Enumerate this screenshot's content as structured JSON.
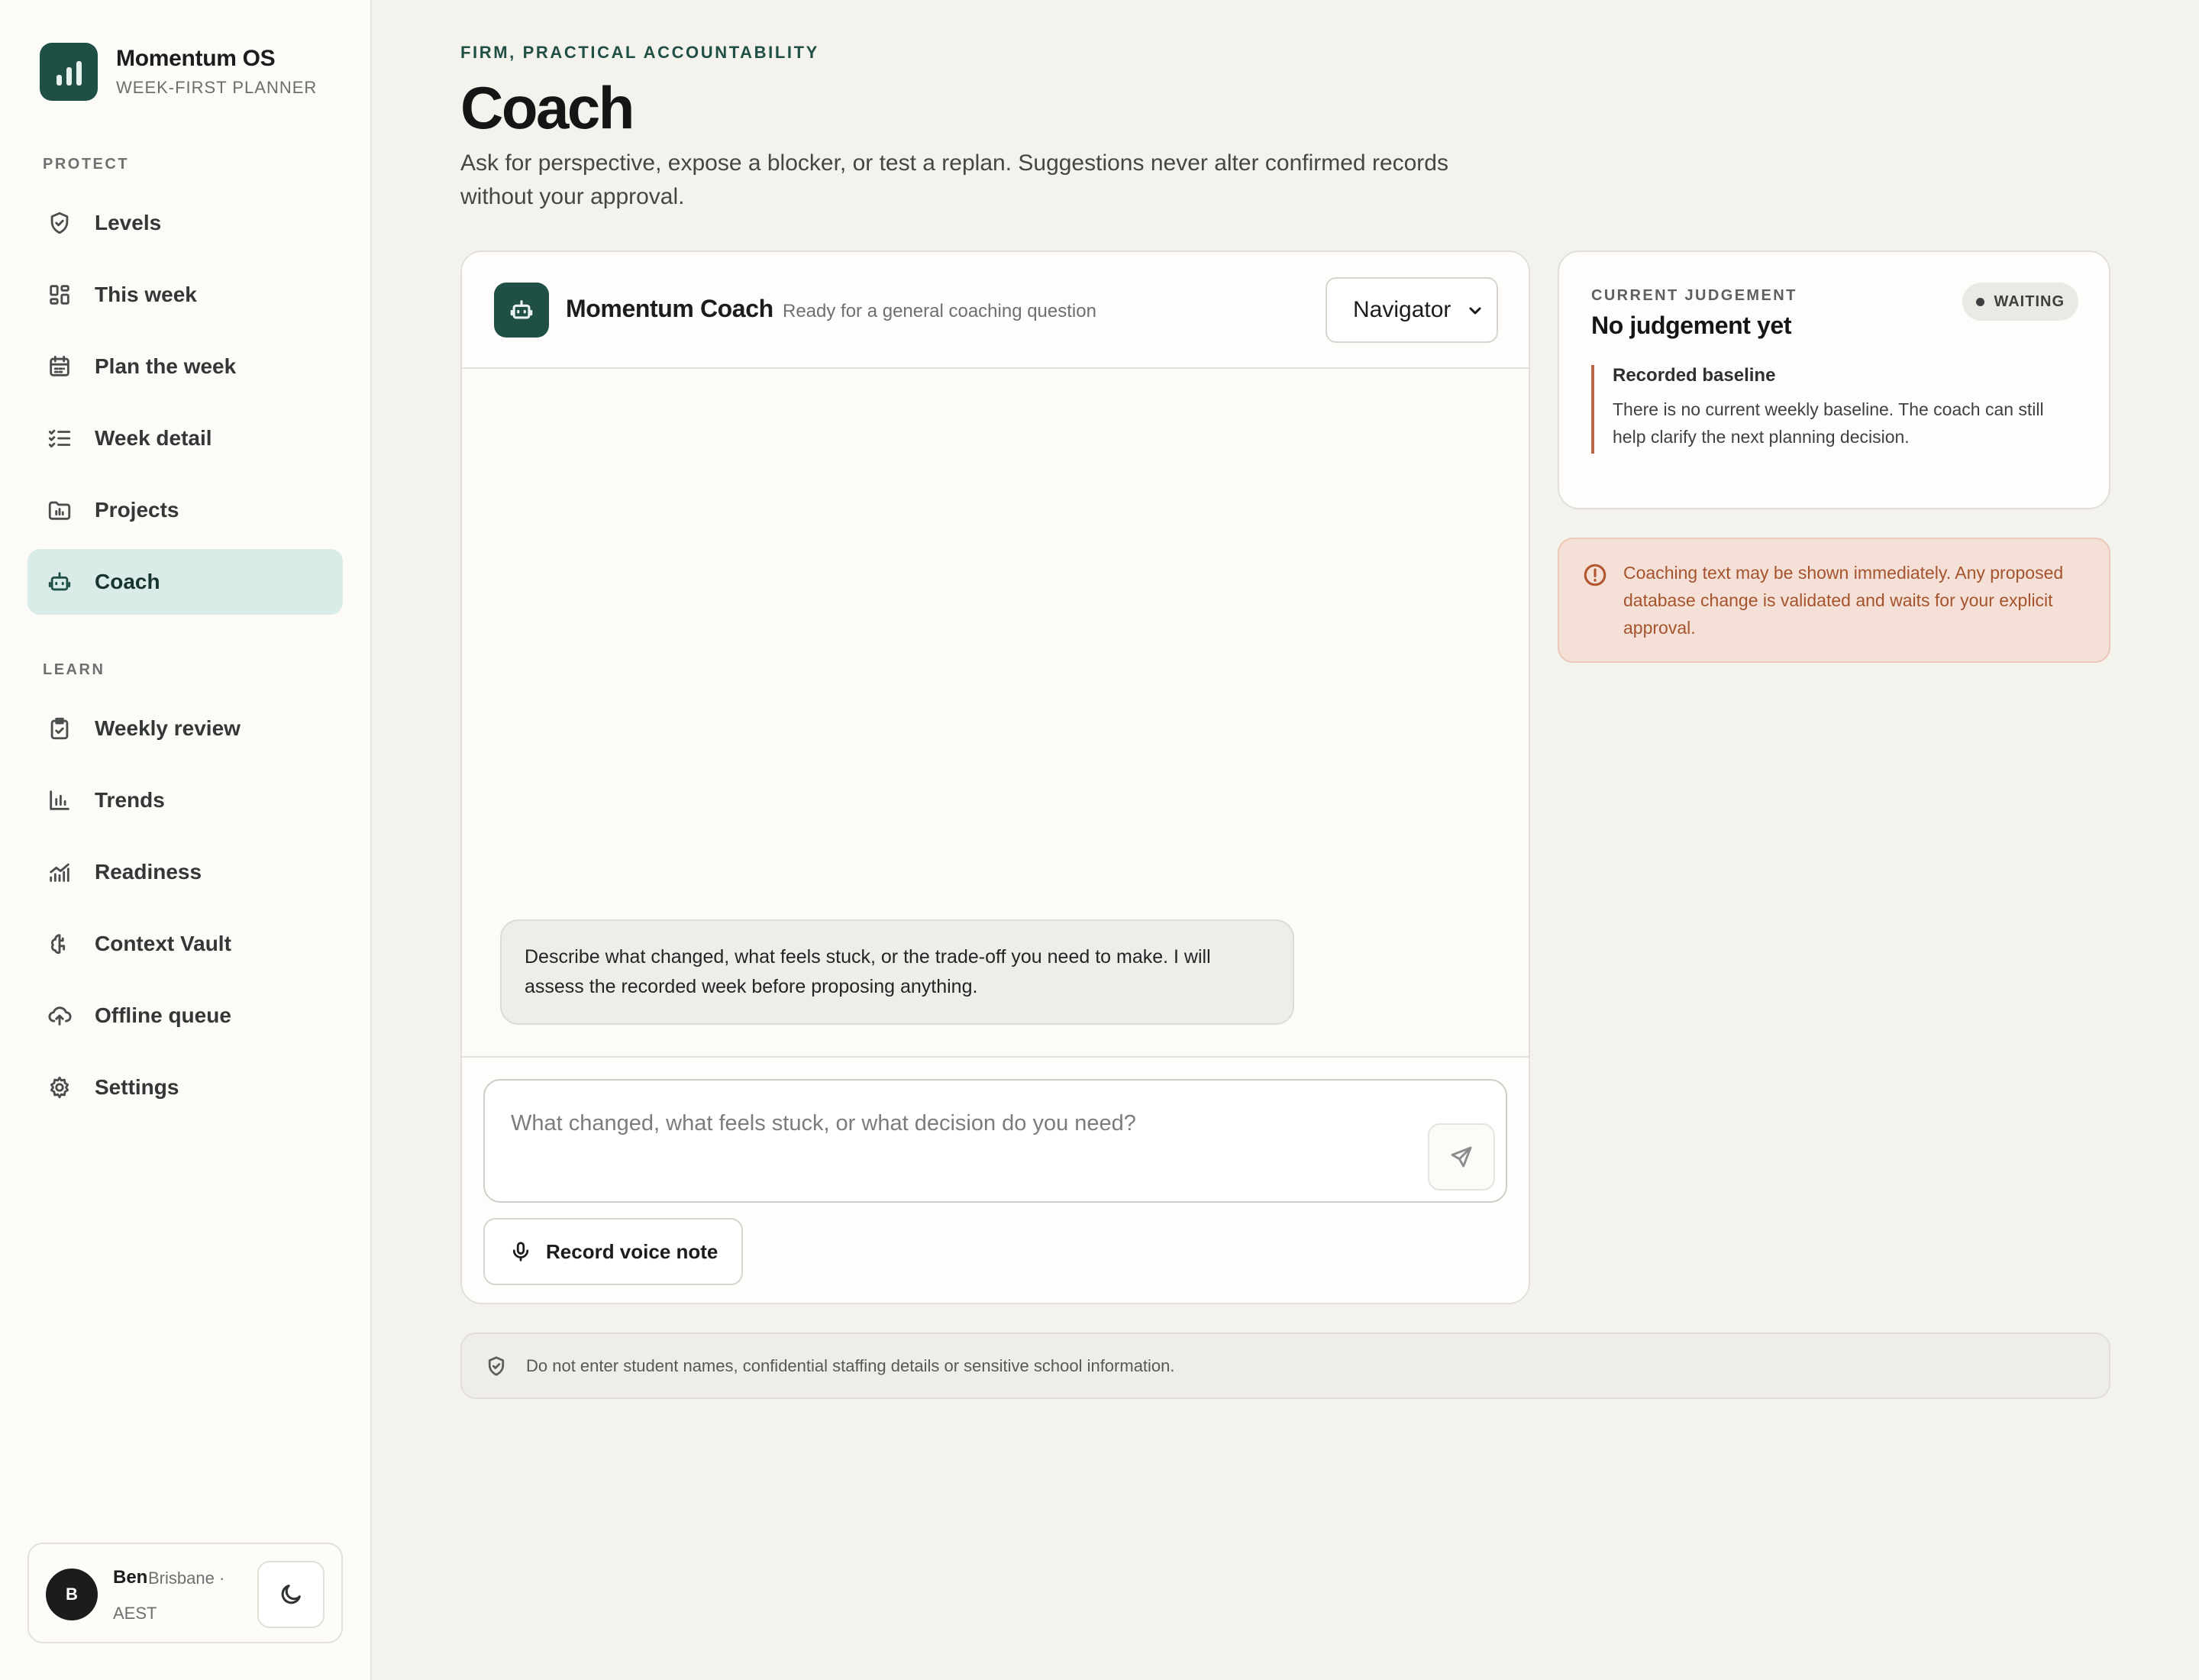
{
  "brand": {
    "name": "Momentum OS",
    "subtitle": "WEEK-FIRST PLANNER"
  },
  "sidebar": {
    "sections": [
      {
        "label": "PROTECT",
        "items": [
          {
            "label": "Levels",
            "icon": "shield-check-icon"
          },
          {
            "label": "This week",
            "icon": "layout-grid-icon"
          },
          {
            "label": "Plan the week",
            "icon": "calendar-icon"
          },
          {
            "label": "Week detail",
            "icon": "checklist-icon"
          },
          {
            "label": "Projects",
            "icon": "folder-chart-icon"
          },
          {
            "label": "Coach",
            "icon": "robot-icon",
            "active": true
          }
        ]
      },
      {
        "label": "LEARN",
        "items": [
          {
            "label": "Weekly review",
            "icon": "clipboard-check-icon"
          },
          {
            "label": "Trends",
            "icon": "bar-chart-icon"
          },
          {
            "label": "Readiness",
            "icon": "chart-line-icon"
          },
          {
            "label": "Context Vault",
            "icon": "brain-icon"
          },
          {
            "label": "Offline queue",
            "icon": "cloud-upload-icon"
          },
          {
            "label": "Settings",
            "icon": "gear-icon"
          }
        ]
      }
    ],
    "user": {
      "initial": "B",
      "name": "Ben",
      "location": "Brisbane ·",
      "timezone": "AEST"
    }
  },
  "header": {
    "eyebrow": "FIRM, PRACTICAL ACCOUNTABILITY",
    "title": "Coach",
    "description": "Ask for perspective, expose a blocker, or test a replan. Suggestions never alter confirmed records without your approval."
  },
  "chat": {
    "coach_name": "Momentum Coach",
    "status": "Ready for a general coaching question",
    "mode": {
      "selected": "Navigator"
    },
    "messages": [
      {
        "role": "coach",
        "text": "Describe what changed, what feels stuck, or the trade-off you need to make. I will assess the recorded week before proposing anything."
      }
    ],
    "composer": {
      "placeholder": "What changed, what feels stuck, or what decision do you need?"
    },
    "voice_label": "Record voice note"
  },
  "judgement": {
    "eyebrow": "CURRENT JUDGEMENT",
    "title": "No judgement yet",
    "badge": "WAITING",
    "baseline_title": "Recorded baseline",
    "baseline_text": "There is no current weekly baseline. The coach can still help clarify the next planning decision."
  },
  "notice": {
    "text": "Coaching text may be shown immediately. Any proposed database change is validated and waits for your explicit approval."
  },
  "privacy": {
    "text": "Do not enter student names, confidential staffing details or sensitive school information."
  },
  "colors": {
    "accent": "#1f4f45",
    "active_nav_bg": "#daece8",
    "warning_text": "#a5532d",
    "warning_bg": "#f5e0d7"
  }
}
